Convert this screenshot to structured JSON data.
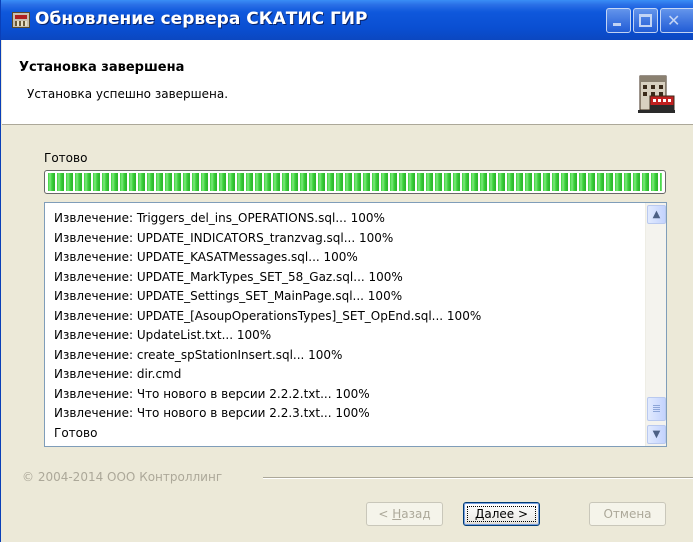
{
  "window": {
    "title": "Обновление сервера СКАТИС ГИР"
  },
  "header": {
    "title": "Установка завершена",
    "subtitle": "Установка успешно завершена."
  },
  "progress": {
    "label": "Готово",
    "percent": 100
  },
  "log": {
    "lines": [
      "Извлечение: Triggers_del_ins_OPERATIONS.sql... 100%",
      "Извлечение: UPDATE_INDICATORS_tranzvag.sql... 100%",
      "Извлечение: UPDATE_KASATMessages.sql... 100%",
      "Извлечение: UPDATE_MarkTypes_SET_58_Gaz.sql... 100%",
      "Извлечение: UPDATE_Settings_SET_MainPage.sql... 100%",
      "Извлечение: UPDATE_[AsoupOperationsTypes]_SET_OpEnd.sql... 100%",
      "Извлечение: UpdateList.txt... 100%",
      "Извлечение: create_spStationInsert.sql... 100%",
      "Извлечение: dir.cmd",
      "Извлечение: Что нового в версии 2.2.2.txt... 100%",
      "Извлечение: Что нового в версии 2.2.3.txt... 100%",
      "Готово"
    ]
  },
  "footer": {
    "copyright": "© 2004-2014 ООО Контроллинг"
  },
  "buttons": {
    "back_prefix": "< ",
    "back_accel": "Н",
    "back_rest": "азад",
    "next_accel": "Д",
    "next_rest": "алее >",
    "cancel": "Отмена"
  },
  "icons": {
    "title": "installer-app-icon",
    "header": "server-building-icon",
    "minimize": "minimize-icon",
    "maximize": "maximize-icon",
    "close": "close-icon",
    "scroll_up": "arrow-up-icon",
    "scroll_down": "arrow-down-icon"
  }
}
